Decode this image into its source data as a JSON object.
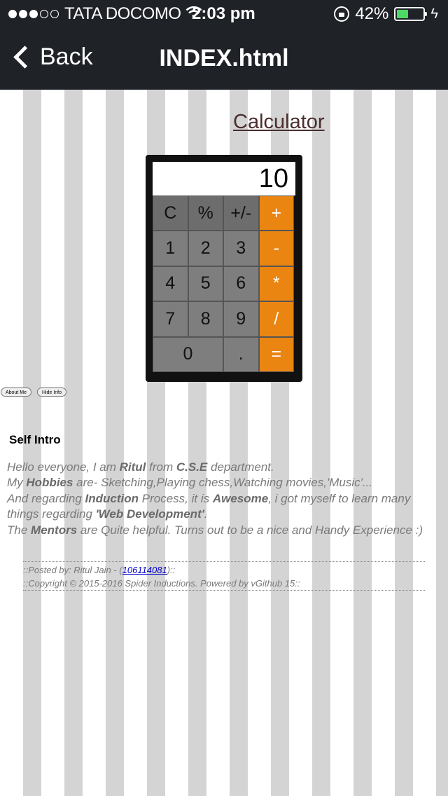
{
  "status_bar": {
    "signal_strength": 3,
    "signal_max": 5,
    "carrier": "TATA DOCOMO",
    "time": "2:03 pm",
    "battery": "42%",
    "battery_fraction": 0.42
  },
  "navbar": {
    "back_label": "Back",
    "title": "INDEX.html"
  },
  "calculator": {
    "link_label": "Calculator",
    "display_value": "10",
    "keys": [
      {
        "label": "C",
        "type": "fn"
      },
      {
        "label": "%",
        "type": "fn"
      },
      {
        "label": "+/-",
        "type": "fn"
      },
      {
        "label": "+",
        "type": "op"
      },
      {
        "label": "1",
        "type": "num"
      },
      {
        "label": "2",
        "type": "num"
      },
      {
        "label": "3",
        "type": "num"
      },
      {
        "label": "-",
        "type": "op"
      },
      {
        "label": "4",
        "type": "num"
      },
      {
        "label": "5",
        "type": "num"
      },
      {
        "label": "6",
        "type": "num"
      },
      {
        "label": "*",
        "type": "op"
      },
      {
        "label": "7",
        "type": "num"
      },
      {
        "label": "8",
        "type": "num"
      },
      {
        "label": "9",
        "type": "num"
      },
      {
        "label": "/",
        "type": "op"
      },
      {
        "label": "0",
        "type": "zero"
      },
      {
        "label": ".",
        "type": "num"
      },
      {
        "label": "=",
        "type": "op"
      }
    ]
  },
  "buttons": {
    "about_me": "About Me",
    "hide_info": "Hide Info"
  },
  "intro": {
    "heading": "Self Intro",
    "line1": {
      "a": "Hello everyone, I am ",
      "b1": "Ritul",
      "c": " from ",
      "b2": "C.S.E",
      "d": " department."
    },
    "line2": {
      "a": "My ",
      "b1": "Hobbies",
      "c": " are- Sketching,Playing chess,Watching movies,'Music'..."
    },
    "line3": {
      "a": "And regarding ",
      "b1": "Induction",
      "c": " Process, it is ",
      "b2": "Awesome",
      "d": ", i got myself to learn many things regarding ",
      "b3": "'Web Development'",
      "e": "."
    },
    "line4": {
      "a": "The ",
      "b1": "Mentors",
      "c": " are Quite helpful. Turns out to be a nice and Handy Experience :)"
    }
  },
  "footer": {
    "posted_prefix": "::Posted by: Ritul Jain - (",
    "roll_number": "106114081",
    "posted_suffix": ")::",
    "copyright": "::Copyright © 2015-2016 Spider Inductions. Powered by vGithub 15::"
  }
}
